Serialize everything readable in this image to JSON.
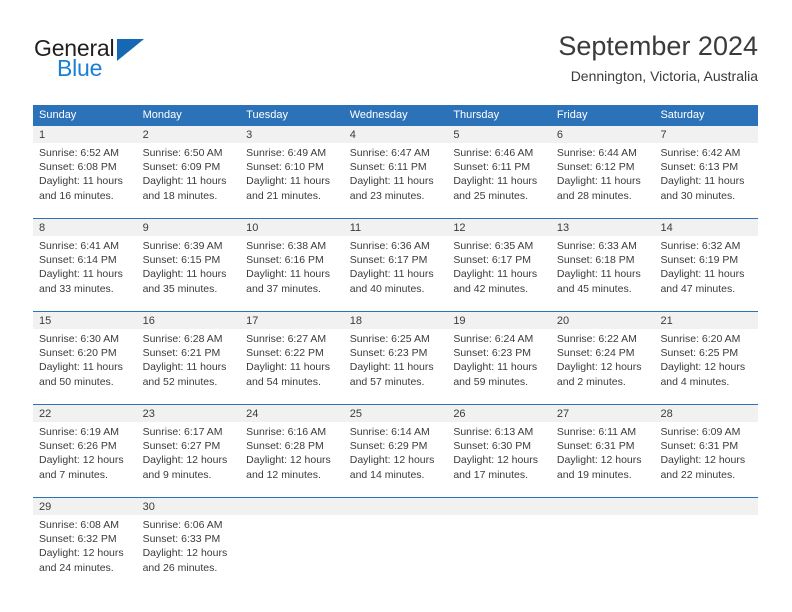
{
  "brand": {
    "name_top": "General",
    "name_bottom": "Blue",
    "accent_color": "#1b7fd4",
    "triangle_color": "#1668b3"
  },
  "header": {
    "title": "September 2024",
    "subtitle": "Dennington, Victoria, Australia"
  },
  "calendar": {
    "header_bg": "#2c72b8",
    "day_band_bg": "#f1f1f1",
    "weekdays": [
      "Sunday",
      "Monday",
      "Tuesday",
      "Wednesday",
      "Thursday",
      "Friday",
      "Saturday"
    ],
    "weeks": [
      [
        {
          "day": "1",
          "sunrise": "Sunrise: 6:52 AM",
          "sunset": "Sunset: 6:08 PM",
          "daylight_line1": "Daylight: 11 hours",
          "daylight_line2": "and 16 minutes."
        },
        {
          "day": "2",
          "sunrise": "Sunrise: 6:50 AM",
          "sunset": "Sunset: 6:09 PM",
          "daylight_line1": "Daylight: 11 hours",
          "daylight_line2": "and 18 minutes."
        },
        {
          "day": "3",
          "sunrise": "Sunrise: 6:49 AM",
          "sunset": "Sunset: 6:10 PM",
          "daylight_line1": "Daylight: 11 hours",
          "daylight_line2": "and 21 minutes."
        },
        {
          "day": "4",
          "sunrise": "Sunrise: 6:47 AM",
          "sunset": "Sunset: 6:11 PM",
          "daylight_line1": "Daylight: 11 hours",
          "daylight_line2": "and 23 minutes."
        },
        {
          "day": "5",
          "sunrise": "Sunrise: 6:46 AM",
          "sunset": "Sunset: 6:11 PM",
          "daylight_line1": "Daylight: 11 hours",
          "daylight_line2": "and 25 minutes."
        },
        {
          "day": "6",
          "sunrise": "Sunrise: 6:44 AM",
          "sunset": "Sunset: 6:12 PM",
          "daylight_line1": "Daylight: 11 hours",
          "daylight_line2": "and 28 minutes."
        },
        {
          "day": "7",
          "sunrise": "Sunrise: 6:42 AM",
          "sunset": "Sunset: 6:13 PM",
          "daylight_line1": "Daylight: 11 hours",
          "daylight_line2": "and 30 minutes."
        }
      ],
      [
        {
          "day": "8",
          "sunrise": "Sunrise: 6:41 AM",
          "sunset": "Sunset: 6:14 PM",
          "daylight_line1": "Daylight: 11 hours",
          "daylight_line2": "and 33 minutes."
        },
        {
          "day": "9",
          "sunrise": "Sunrise: 6:39 AM",
          "sunset": "Sunset: 6:15 PM",
          "daylight_line1": "Daylight: 11 hours",
          "daylight_line2": "and 35 minutes."
        },
        {
          "day": "10",
          "sunrise": "Sunrise: 6:38 AM",
          "sunset": "Sunset: 6:16 PM",
          "daylight_line1": "Daylight: 11 hours",
          "daylight_line2": "and 37 minutes."
        },
        {
          "day": "11",
          "sunrise": "Sunrise: 6:36 AM",
          "sunset": "Sunset: 6:17 PM",
          "daylight_line1": "Daylight: 11 hours",
          "daylight_line2": "and 40 minutes."
        },
        {
          "day": "12",
          "sunrise": "Sunrise: 6:35 AM",
          "sunset": "Sunset: 6:17 PM",
          "daylight_line1": "Daylight: 11 hours",
          "daylight_line2": "and 42 minutes."
        },
        {
          "day": "13",
          "sunrise": "Sunrise: 6:33 AM",
          "sunset": "Sunset: 6:18 PM",
          "daylight_line1": "Daylight: 11 hours",
          "daylight_line2": "and 45 minutes."
        },
        {
          "day": "14",
          "sunrise": "Sunrise: 6:32 AM",
          "sunset": "Sunset: 6:19 PM",
          "daylight_line1": "Daylight: 11 hours",
          "daylight_line2": "and 47 minutes."
        }
      ],
      [
        {
          "day": "15",
          "sunrise": "Sunrise: 6:30 AM",
          "sunset": "Sunset: 6:20 PM",
          "daylight_line1": "Daylight: 11 hours",
          "daylight_line2": "and 50 minutes."
        },
        {
          "day": "16",
          "sunrise": "Sunrise: 6:28 AM",
          "sunset": "Sunset: 6:21 PM",
          "daylight_line1": "Daylight: 11 hours",
          "daylight_line2": "and 52 minutes."
        },
        {
          "day": "17",
          "sunrise": "Sunrise: 6:27 AM",
          "sunset": "Sunset: 6:22 PM",
          "daylight_line1": "Daylight: 11 hours",
          "daylight_line2": "and 54 minutes."
        },
        {
          "day": "18",
          "sunrise": "Sunrise: 6:25 AM",
          "sunset": "Sunset: 6:23 PM",
          "daylight_line1": "Daylight: 11 hours",
          "daylight_line2": "and 57 minutes."
        },
        {
          "day": "19",
          "sunrise": "Sunrise: 6:24 AM",
          "sunset": "Sunset: 6:23 PM",
          "daylight_line1": "Daylight: 11 hours",
          "daylight_line2": "and 59 minutes."
        },
        {
          "day": "20",
          "sunrise": "Sunrise: 6:22 AM",
          "sunset": "Sunset: 6:24 PM",
          "daylight_line1": "Daylight: 12 hours",
          "daylight_line2": "and 2 minutes."
        },
        {
          "day": "21",
          "sunrise": "Sunrise: 6:20 AM",
          "sunset": "Sunset: 6:25 PM",
          "daylight_line1": "Daylight: 12 hours",
          "daylight_line2": "and 4 minutes."
        }
      ],
      [
        {
          "day": "22",
          "sunrise": "Sunrise: 6:19 AM",
          "sunset": "Sunset: 6:26 PM",
          "daylight_line1": "Daylight: 12 hours",
          "daylight_line2": "and 7 minutes."
        },
        {
          "day": "23",
          "sunrise": "Sunrise: 6:17 AM",
          "sunset": "Sunset: 6:27 PM",
          "daylight_line1": "Daylight: 12 hours",
          "daylight_line2": "and 9 minutes."
        },
        {
          "day": "24",
          "sunrise": "Sunrise: 6:16 AM",
          "sunset": "Sunset: 6:28 PM",
          "daylight_line1": "Daylight: 12 hours",
          "daylight_line2": "and 12 minutes."
        },
        {
          "day": "25",
          "sunrise": "Sunrise: 6:14 AM",
          "sunset": "Sunset: 6:29 PM",
          "daylight_line1": "Daylight: 12 hours",
          "daylight_line2": "and 14 minutes."
        },
        {
          "day": "26",
          "sunrise": "Sunrise: 6:13 AM",
          "sunset": "Sunset: 6:30 PM",
          "daylight_line1": "Daylight: 12 hours",
          "daylight_line2": "and 17 minutes."
        },
        {
          "day": "27",
          "sunrise": "Sunrise: 6:11 AM",
          "sunset": "Sunset: 6:31 PM",
          "daylight_line1": "Daylight: 12 hours",
          "daylight_line2": "and 19 minutes."
        },
        {
          "day": "28",
          "sunrise": "Sunrise: 6:09 AM",
          "sunset": "Sunset: 6:31 PM",
          "daylight_line1": "Daylight: 12 hours",
          "daylight_line2": "and 22 minutes."
        }
      ],
      [
        {
          "day": "29",
          "sunrise": "Sunrise: 6:08 AM",
          "sunset": "Sunset: 6:32 PM",
          "daylight_line1": "Daylight: 12 hours",
          "daylight_line2": "and 24 minutes."
        },
        {
          "day": "30",
          "sunrise": "Sunrise: 6:06 AM",
          "sunset": "Sunset: 6:33 PM",
          "daylight_line1": "Daylight: 12 hours",
          "daylight_line2": "and 26 minutes."
        },
        {
          "day": "",
          "sunrise": "",
          "sunset": "",
          "daylight_line1": "",
          "daylight_line2": ""
        },
        {
          "day": "",
          "sunrise": "",
          "sunset": "",
          "daylight_line1": "",
          "daylight_line2": ""
        },
        {
          "day": "",
          "sunrise": "",
          "sunset": "",
          "daylight_line1": "",
          "daylight_line2": ""
        },
        {
          "day": "",
          "sunrise": "",
          "sunset": "",
          "daylight_line1": "",
          "daylight_line2": ""
        },
        {
          "day": "",
          "sunrise": "",
          "sunset": "",
          "daylight_line1": "",
          "daylight_line2": ""
        }
      ]
    ]
  }
}
